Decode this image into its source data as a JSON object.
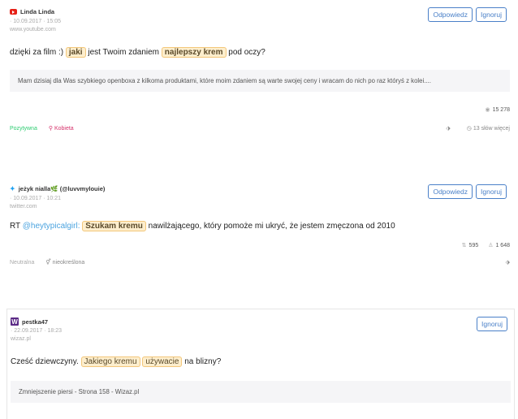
{
  "mentions": [
    {
      "author": "Linda Linda",
      "date": "10.09.2017 · 15:05",
      "source": "www.youtube.com",
      "reply_label": "Odpowiedz",
      "ignore_label": "Ignoruj",
      "text_parts": [
        "dzięki za film :) ",
        "jaki",
        " jest Twoim zdaniem ",
        "najlepszy krem",
        " pod oczy?"
      ],
      "quote": "Mam dzisiaj dla Was szybkiego openboxa z kilkoma produktami, które moim zdaniem są warte swojej ceny i wracam do nich po raz któryś z kolei....",
      "views": "15 278",
      "sentiment": "Pozytywna",
      "gender": "Kobieta",
      "more_words": "13 słów więcej"
    },
    {
      "author": "jeżyk nialla🌿 (@luvvmylouie)",
      "date": "10.09.2017 · 10:21",
      "source": "twitter.com",
      "reply_label": "Odpowiedz",
      "ignore_label": "Ignoruj",
      "text_parts": [
        "RT ",
        "@heytypicalgirl:",
        " ",
        "Szukam kremu",
        " nawilżającego, który pomoże mi ukryć, że jestem zmęczona od 2010"
      ],
      "retweets": "595",
      "followers": "1 648",
      "sentiment": "Neutralna",
      "gender": "nieokreślona"
    },
    {
      "author": "pestka47",
      "date": "22.09.2017 · 18:23",
      "source": "wizaz.pl",
      "ignore_label": "Ignoruj",
      "text_parts": [
        "Cześć dziewczyny. ",
        "Jakiego kremu",
        " ",
        "używacie",
        " na blizny?"
      ],
      "quote": "Zmniejszenie piersi - Strona 158 - Wizaz.pl"
    }
  ],
  "icons": {
    "eye": "eye-icon",
    "tag": "tag-icon",
    "clock": "clock-icon",
    "retweet": "retweet-icon",
    "person": "person-icon"
  },
  "colors": {
    "accent": "#4a80c8",
    "highlight": "#fdeecd",
    "positive": "#2ecc71",
    "female": "#d6336c"
  }
}
